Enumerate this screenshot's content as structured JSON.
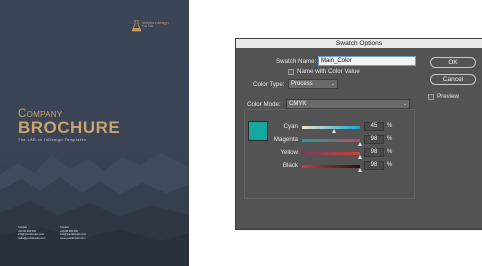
{
  "brochure": {
    "logo_text": "sixtyfourdesign",
    "logo_subtext": "THE LAB",
    "title_line1": "Company",
    "title_line2": "BROCHURE",
    "tagline": "The LAB vs InDesign Templates",
    "contact_left": "Contact\n+00 00 000 000\ninfo@yourdomain.com\nhello@yourdomain.com",
    "contact_right": "Contact\n+00 00 000 000\ninfo@yourdomain.com\nwww.yourdomain.com",
    "colors": {
      "background": "#3a4455",
      "title": "#c8a36b"
    }
  },
  "dialog": {
    "title": "Swatch Options",
    "swatch_name_label": "Swatch Name:",
    "swatch_name_value": "Main_Color",
    "name_with_color_value_label": "Name with Color Value",
    "name_with_color_value_checked": false,
    "color_type_label": "Color Type:",
    "color_type_value": "Process",
    "color_mode_label": "Color Mode:",
    "color_mode_value": "CMYK",
    "ok_label": "OK",
    "cancel_label": "Cancel",
    "preview_label": "Preview",
    "preview_checked": false,
    "swatch_color": "#14a89c",
    "percent_sign": "%",
    "channels": [
      {
        "label": "Cyan",
        "value": "45",
        "gradient": [
          "#f1e2c8",
          "#12a7c9"
        ]
      },
      {
        "label": "Magenta",
        "value": "98",
        "gradient": [
          "#14a89c",
          "#c7405e"
        ]
      },
      {
        "label": "Yellow",
        "value": "98",
        "gradient": [
          "#7a3a63",
          "#c9442e"
        ]
      },
      {
        "label": "Black",
        "value": "98",
        "gradient": [
          "#c23c48",
          "#2a1010"
        ]
      }
    ]
  }
}
